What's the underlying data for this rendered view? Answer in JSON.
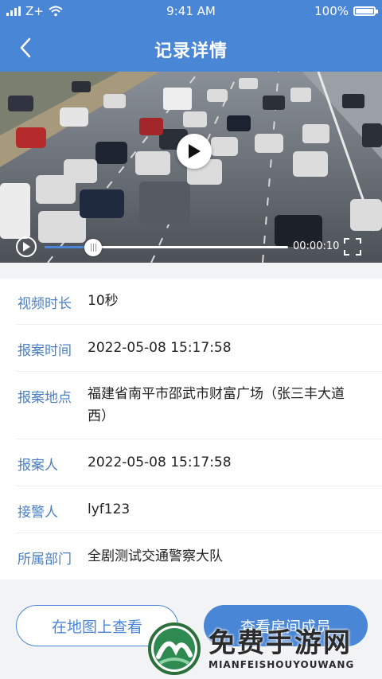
{
  "status_bar": {
    "carrier": "Z+",
    "time": "9:41 AM",
    "battery": "100%"
  },
  "header": {
    "title": "记录详情"
  },
  "video": {
    "duration_display": "00:00:10",
    "progress": 0.2
  },
  "details": [
    {
      "label": "视频时长",
      "value": "10秒"
    },
    {
      "label": "报案时间",
      "value": "2022-05-08 15:17:58"
    },
    {
      "label": "报案地点",
      "value": "福建省南平市邵武市财富广场（张三丰大道西）"
    },
    {
      "label": "报案人",
      "value": "2022-05-08 15:17:58"
    },
    {
      "label": "接警人",
      "value": "lyf123"
    },
    {
      "label": "所属部门",
      "value": "全剧测试交通警察大队"
    }
  ],
  "actions": {
    "map_button": "在地图上查看",
    "members_button": "查看房间成员"
  },
  "watermark": {
    "title": "免费手游网",
    "subtitle": "MIANFEISHOUYOUWANG"
  },
  "colors": {
    "primary": "#4a86d6",
    "label": "#4a7fc6",
    "background": "#f2f3f5"
  }
}
